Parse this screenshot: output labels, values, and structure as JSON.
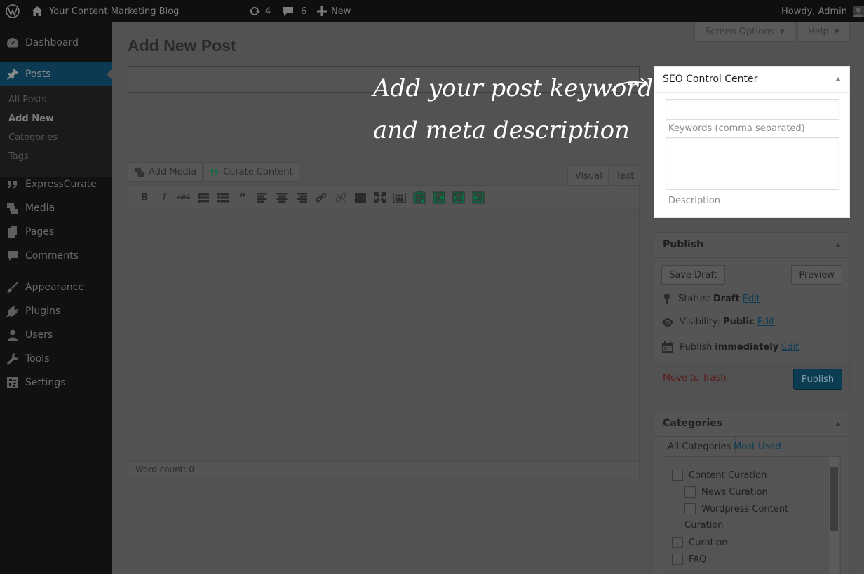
{
  "adminbar": {
    "site_name": "Your Content Marketing Blog",
    "updates_count": "4",
    "comments_count": "6",
    "new_label": "New",
    "howdy": "Howdy, Admin"
  },
  "sidebar": {
    "items": [
      {
        "label": "Dashboard",
        "icon": "dashboard-icon"
      },
      {
        "label": "Posts",
        "icon": "pin-icon"
      },
      {
        "label": "ExpressCurate",
        "icon": "quote-icon"
      },
      {
        "label": "Media",
        "icon": "media-icon"
      },
      {
        "label": "Pages",
        "icon": "pages-icon"
      },
      {
        "label": "Comments",
        "icon": "comment-icon"
      },
      {
        "label": "Appearance",
        "icon": "brush-icon"
      },
      {
        "label": "Plugins",
        "icon": "plug-icon"
      },
      {
        "label": "Users",
        "icon": "user-icon"
      },
      {
        "label": "Tools",
        "icon": "wrench-icon"
      },
      {
        "label": "Settings",
        "icon": "settings-icon"
      }
    ],
    "submenu": [
      "All Posts",
      "Add New",
      "Categories",
      "Tags"
    ]
  },
  "header": {
    "screen_options": "Screen Options",
    "help": "Help",
    "page_title": "Add New Post"
  },
  "editor": {
    "add_media": "Add Media",
    "curate_content": "Curate Content",
    "tab_visual": "Visual",
    "tab_text": "Text",
    "word_count": "Word count: 0"
  },
  "annotation": {
    "line1": "Add your post keywords",
    "line2": "and meta description"
  },
  "seo": {
    "title": "SEO Control Center",
    "keywords_label": "Keywords (comma separated)",
    "description_label": "Description"
  },
  "publish": {
    "title": "Publish",
    "save_draft": "Save Draft",
    "preview": "Preview",
    "status_label": "Status:",
    "status_value": "Draft",
    "visibility_label": "Visibility:",
    "visibility_value": "Public",
    "publish_label": "Publish",
    "publish_value": "immediately",
    "edit": "Edit",
    "move_to_trash": "Move to Trash",
    "publish_button": "Publish"
  },
  "categories": {
    "title": "Categories",
    "tab_all": "All Categories",
    "tab_most_used": "Most Used",
    "items": [
      "Content Curation",
      "News Curation",
      "Wordpress Content",
      "Curation",
      "Curation",
      "FAQ"
    ]
  },
  "colors": {
    "accent": "#0b3c52",
    "highlight_panel": "#ffffff",
    "annotation_text": "#ffffff"
  }
}
